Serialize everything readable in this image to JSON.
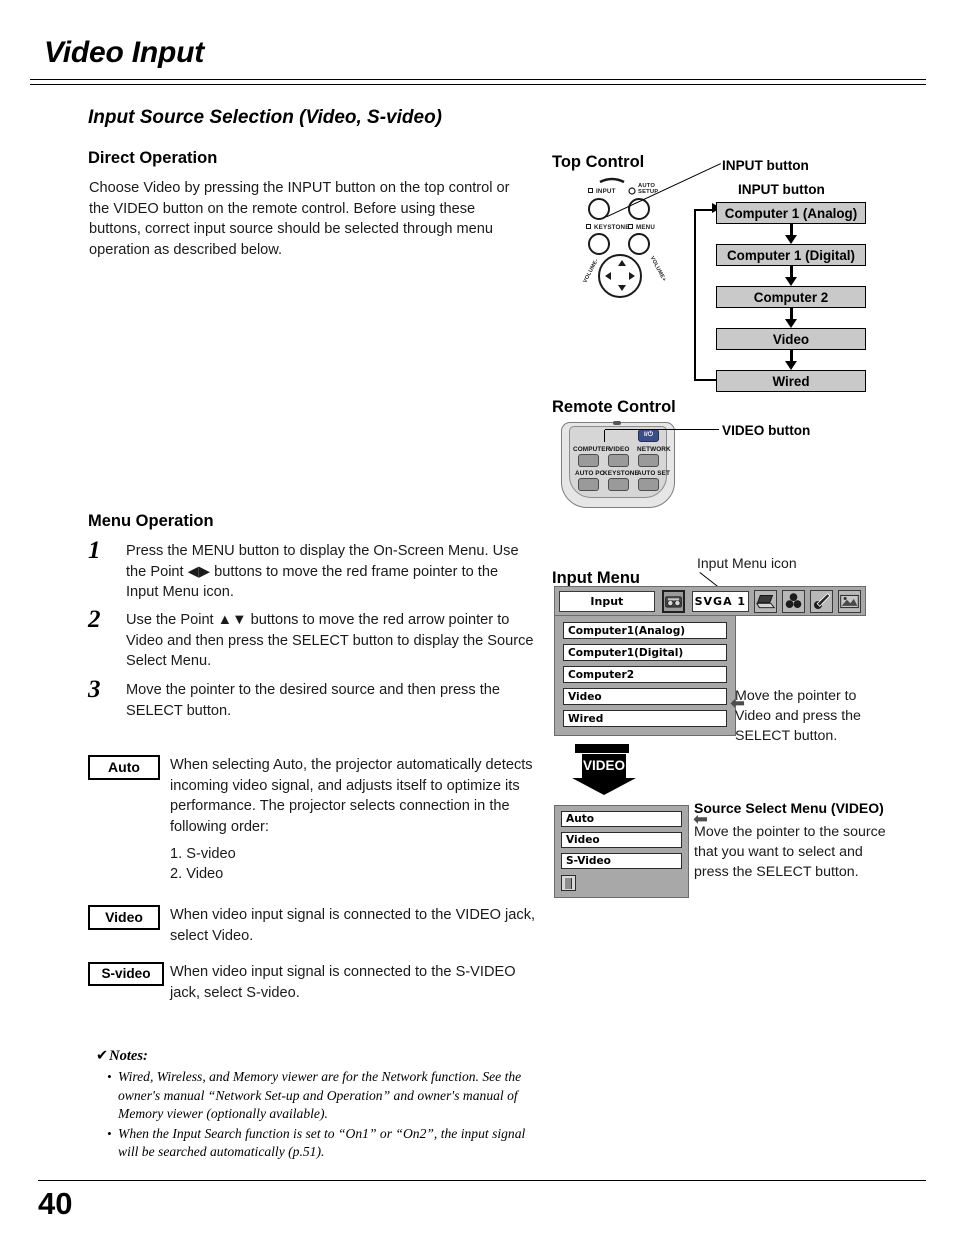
{
  "page": {
    "title": "Video Input",
    "number": "40"
  },
  "section": {
    "title": "Input Source Selection (Video, S-video)"
  },
  "direct_operation": {
    "heading": "Direct Operation",
    "text": "Choose Video by pressing the INPUT button on the top control or the VIDEO button on the remote control. Before using these buttons, correct input source should be selected through menu operation as described below."
  },
  "menu_operation": {
    "heading": "Menu Operation",
    "steps": [
      {
        "num": "1",
        "text": "Press the MENU button to display the On-Screen Menu. Use the Point ◀▶ buttons to move the red frame pointer to the Input Menu icon."
      },
      {
        "num": "2",
        "text": "Use the Point ▲▼ buttons to move the red arrow pointer to Video and then press the SELECT button to display the Source Select Menu."
      },
      {
        "num": "3",
        "text": "Move the pointer to the desired source and then press the SELECT button."
      }
    ]
  },
  "definitions": [
    {
      "tag": "Auto",
      "text": "When selecting Auto, the projector automatically detects incoming video signal, and adjusts itself to optimize its performance. The projector selects connection in the following order:",
      "order": [
        "1. S-video",
        "2. Video"
      ]
    },
    {
      "tag": "Video",
      "text": "When video input signal is connected to the VIDEO jack, select Video."
    },
    {
      "tag": "S-video",
      "text": "When video input signal is connected to the S-VIDEO jack, select S-video."
    }
  ],
  "notes": {
    "heading": "Notes:",
    "check_icon": "✔",
    "items": [
      "Wired, Wireless, and Memory viewer are for the Network function. See the owner's manual “Network Set-up and Operation” and owner's manual of Memory viewer (optionally available).",
      "When the Input Search function is set to “On1” or “On2”, the input signal will be searched automatically (p.51)."
    ]
  },
  "top_control": {
    "heading": "Top Control",
    "callout_input_button": "INPUT button",
    "buttons": [
      {
        "label": "INPUT",
        "icon": "input-icon"
      },
      {
        "label": "AUTO SETUP",
        "icon": "auto-setup-icon"
      },
      {
        "label": "KEYSTONE",
        "icon": "keystone-icon"
      },
      {
        "label": "MENU",
        "icon": "menu-icon"
      }
    ],
    "dial_labels": [
      "VOLUME-",
      "VOLUME+"
    ]
  },
  "input_flow": {
    "heading": "INPUT button",
    "items": [
      "Computer 1 (Analog)",
      "Computer 1 (Digital)",
      "Computer 2",
      "Video",
      "Wired"
    ],
    "box_color": "#c9c9c9"
  },
  "remote_control": {
    "heading": "Remote Control",
    "callout_video_button": "VIDEO button",
    "keys": [
      {
        "label": "COMPUTER",
        "icon": "computer-icon"
      },
      {
        "label": "VIDEO",
        "icon": "video-icon"
      },
      {
        "label": "NETWORK",
        "icon": "network-icon"
      },
      {
        "label": "AUTO PC",
        "icon": "auto-pc-icon"
      },
      {
        "label": "KEYSTONE",
        "icon": "keystone-icon"
      },
      {
        "label": "AUTO SET",
        "icon": "auto-set-icon"
      },
      {
        "label": "I/⏻",
        "icon": "power-icon"
      }
    ]
  },
  "input_menu": {
    "heading": "Input Menu",
    "icon_callout": "Input Menu icon",
    "bar": {
      "title_field": "Input",
      "mode_field": "SVGA 1",
      "icons": [
        "input-menu-icon",
        "computer-menu-icon",
        "color-adjust-menu-icon",
        "setting-menu-icon",
        "screen-menu-icon"
      ]
    },
    "items": [
      "Computer1(Analog)",
      "Computer1(Digital)",
      "Computer2",
      "Video",
      "Wired"
    ],
    "pointer_target": "Video",
    "note": "Move the pointer to Video and press the SELECT button."
  },
  "video_arrow": {
    "label": "VIDEO"
  },
  "source_select_menu": {
    "title": "Source Select Menu (VIDEO)",
    "items": [
      "Auto",
      "Video",
      "S-Video"
    ],
    "folder_icon": "quit-folder-icon",
    "pointer_target": "Auto",
    "note": "Move the pointer to the source that you want to select and press the SELECT button."
  }
}
